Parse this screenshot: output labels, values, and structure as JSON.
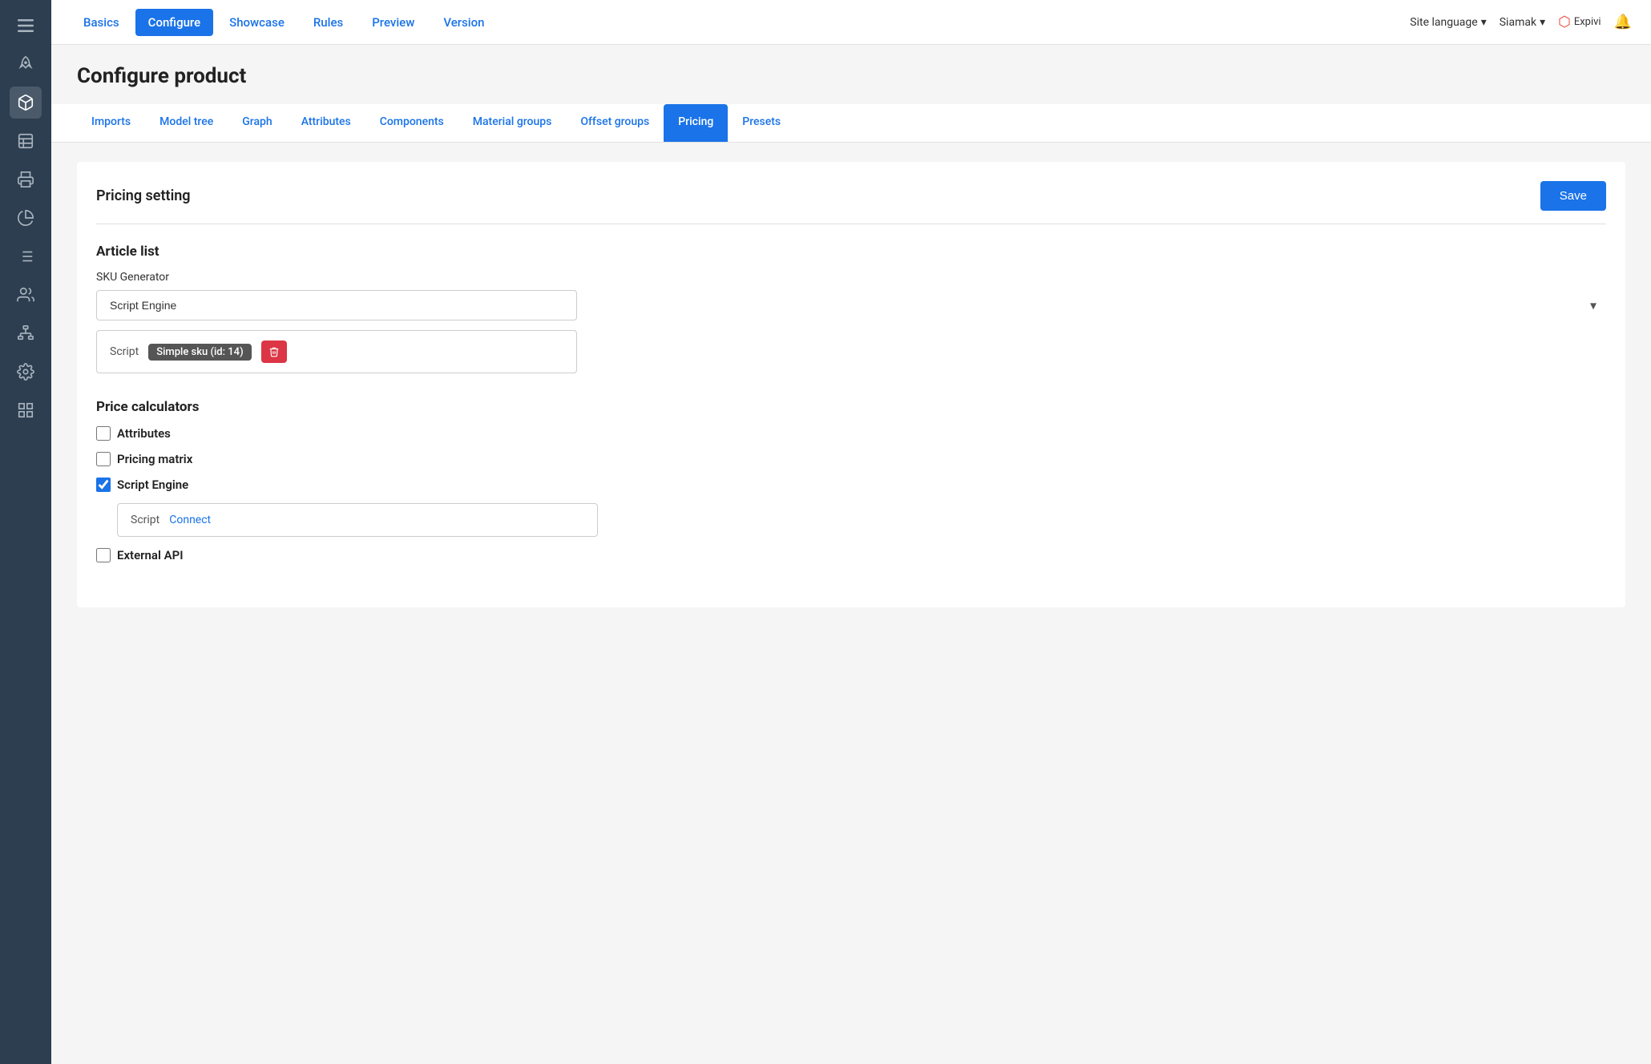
{
  "sidebar": {
    "icons": [
      {
        "name": "hamburger-menu",
        "symbol": "☰",
        "active": false
      },
      {
        "name": "rocket-icon",
        "symbol": "🚀",
        "active": false
      },
      {
        "name": "cube-icon",
        "symbol": "⬛",
        "active": true
      },
      {
        "name": "table-icon",
        "symbol": "⊞",
        "active": false
      },
      {
        "name": "printer-icon",
        "symbol": "🖨",
        "active": false
      },
      {
        "name": "chart-icon",
        "symbol": "◔",
        "active": false
      },
      {
        "name": "list-icon",
        "symbol": "≡",
        "active": false
      },
      {
        "name": "users-icon",
        "symbol": "👥",
        "active": false
      },
      {
        "name": "org-icon",
        "symbol": "⛶",
        "active": false
      },
      {
        "name": "settings-icon",
        "symbol": "⚙",
        "active": false
      },
      {
        "name": "grid-icon",
        "symbol": "⊟",
        "active": false
      }
    ]
  },
  "topnav": {
    "tabs": [
      {
        "label": "Basics",
        "active": false
      },
      {
        "label": "Configure",
        "active": true
      },
      {
        "label": "Showcase",
        "active": false
      },
      {
        "label": "Rules",
        "active": false
      },
      {
        "label": "Preview",
        "active": false
      },
      {
        "label": "Version",
        "active": false
      }
    ],
    "site_language_label": "Site language",
    "user_label": "Siamak",
    "brand_label": "Expivi",
    "bell_symbol": "🔔"
  },
  "page": {
    "title": "Configure product"
  },
  "subtabs": [
    {
      "label": "Imports",
      "active": false
    },
    {
      "label": "Model tree",
      "active": false
    },
    {
      "label": "Graph",
      "active": false
    },
    {
      "label": "Attributes",
      "active": false
    },
    {
      "label": "Components",
      "active": false
    },
    {
      "label": "Material groups",
      "active": false
    },
    {
      "label": "Offset groups",
      "active": false
    },
    {
      "label": "Pricing",
      "active": true
    },
    {
      "label": "Presets",
      "active": false
    }
  ],
  "pricing_setting": {
    "title": "Pricing setting",
    "save_button": "Save"
  },
  "article_list": {
    "title": "Article list",
    "sku_generator_label": "SKU Generator",
    "sku_generator_value": "Script Engine",
    "sku_generator_placeholder": "Script Engine",
    "script_label": "Script",
    "script_tag": "Simple sku (id: 14)",
    "delete_icon": "🗑"
  },
  "price_calculators": {
    "title": "Price calculators",
    "attributes_label": "Attributes",
    "attributes_checked": false,
    "pricing_matrix_label": "Pricing matrix",
    "pricing_matrix_checked": false,
    "script_engine_label": "Script Engine",
    "script_engine_checked": true,
    "script_label": "Script",
    "connect_label": "Connect",
    "external_api_label": "External API",
    "external_api_checked": false
  }
}
